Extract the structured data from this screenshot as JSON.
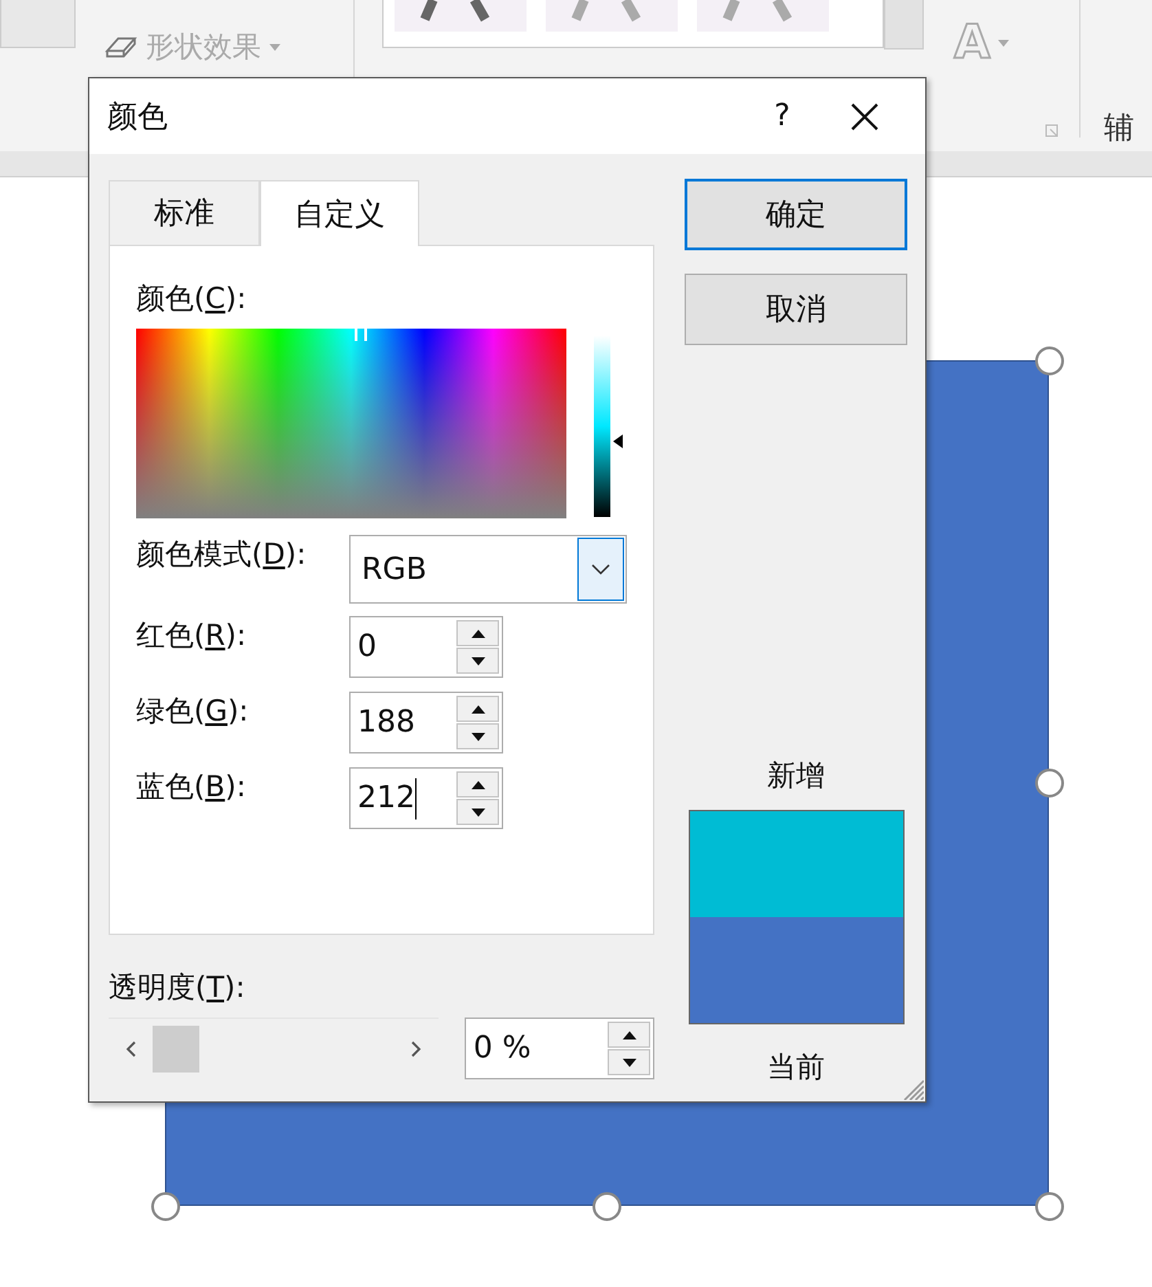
{
  "ribbon": {
    "effects_label": "形状效果",
    "wordart_glyph": "A",
    "group_label": "辅"
  },
  "slide": {
    "shape_selected": true
  },
  "dialog": {
    "title": "颜色",
    "help": "?",
    "tabs": [
      {
        "label": "标准",
        "selected": false
      },
      {
        "label": "自定义",
        "selected": true
      }
    ],
    "picker": {
      "label": {
        "pre": "颜色(",
        "key": "C",
        "post": "):"
      },
      "lightness": {
        "level": 0.42
      }
    },
    "mode": {
      "label": {
        "pre": "颜色模式(",
        "key": "D",
        "post": "):"
      },
      "value": "RGB"
    },
    "channels": [
      {
        "label": {
          "pre": "红色(",
          "key": "R",
          "post": "):"
        },
        "value": "0",
        "focused": false
      },
      {
        "label": {
          "pre": "绿色(",
          "key": "G",
          "post": "):"
        },
        "value": "188",
        "focused": false
      },
      {
        "label": {
          "pre": "蓝色(",
          "key": "B",
          "post": "):"
        },
        "value": "212",
        "focused": true
      }
    ],
    "transparency": {
      "label": {
        "pre": "透明度(",
        "key": "T",
        "post": "):"
      },
      "value": "0 %"
    },
    "buttons": [
      {
        "label": "确定",
        "default": true
      },
      {
        "label": "取消",
        "default": false
      }
    ],
    "preview": {
      "new_label": "新增",
      "current_label": "当前",
      "swatches": [
        {
          "color": "#00bcd4"
        },
        {
          "color": "#4472c4"
        }
      ]
    }
  }
}
